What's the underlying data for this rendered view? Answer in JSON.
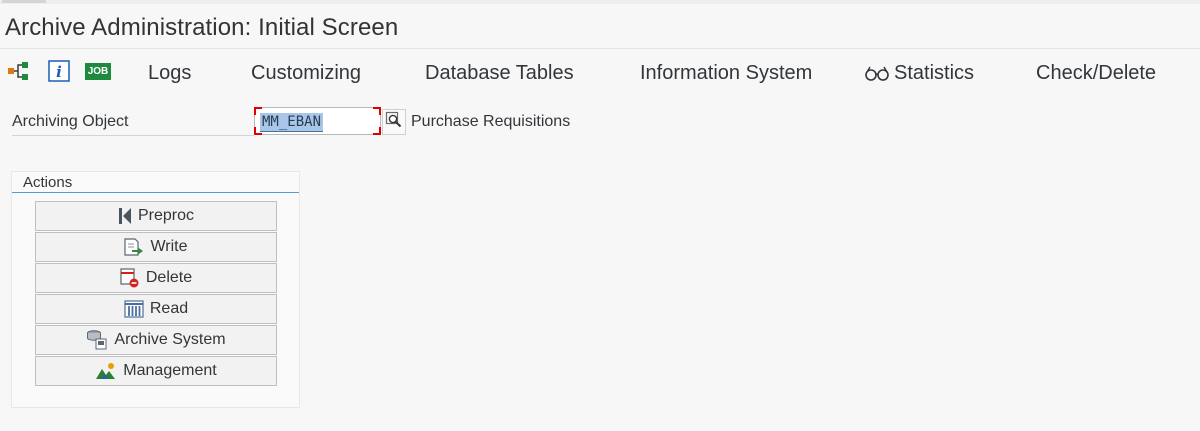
{
  "window": {
    "title": "Archive Administration: Initial Screen"
  },
  "toolbar": {
    "icons": [
      "hierarchy-icon",
      "info-icon",
      "job-icon"
    ],
    "job_icon_text": "JOB",
    "items": {
      "logs": "Logs",
      "customizing": "Customizing",
      "database_tables": "Database Tables",
      "information_system": "Information System",
      "statistics": "Statistics",
      "check_delete": "Check/Delete"
    }
  },
  "archiving_object": {
    "label": "Archiving Object",
    "value": "MM_EBAN",
    "description": "Purchase Requisitions"
  },
  "actions": {
    "title": "Actions",
    "buttons": {
      "preproc": "Preproc",
      "write": "Write",
      "delete": "Delete",
      "read": "Read",
      "archive_system": "Archive System",
      "management": "Management"
    }
  },
  "colors": {
    "accent": "#5a9bd4",
    "job_green": "#1e8a3e",
    "required_red": "#e00000",
    "selection": "#a9c6e8"
  }
}
